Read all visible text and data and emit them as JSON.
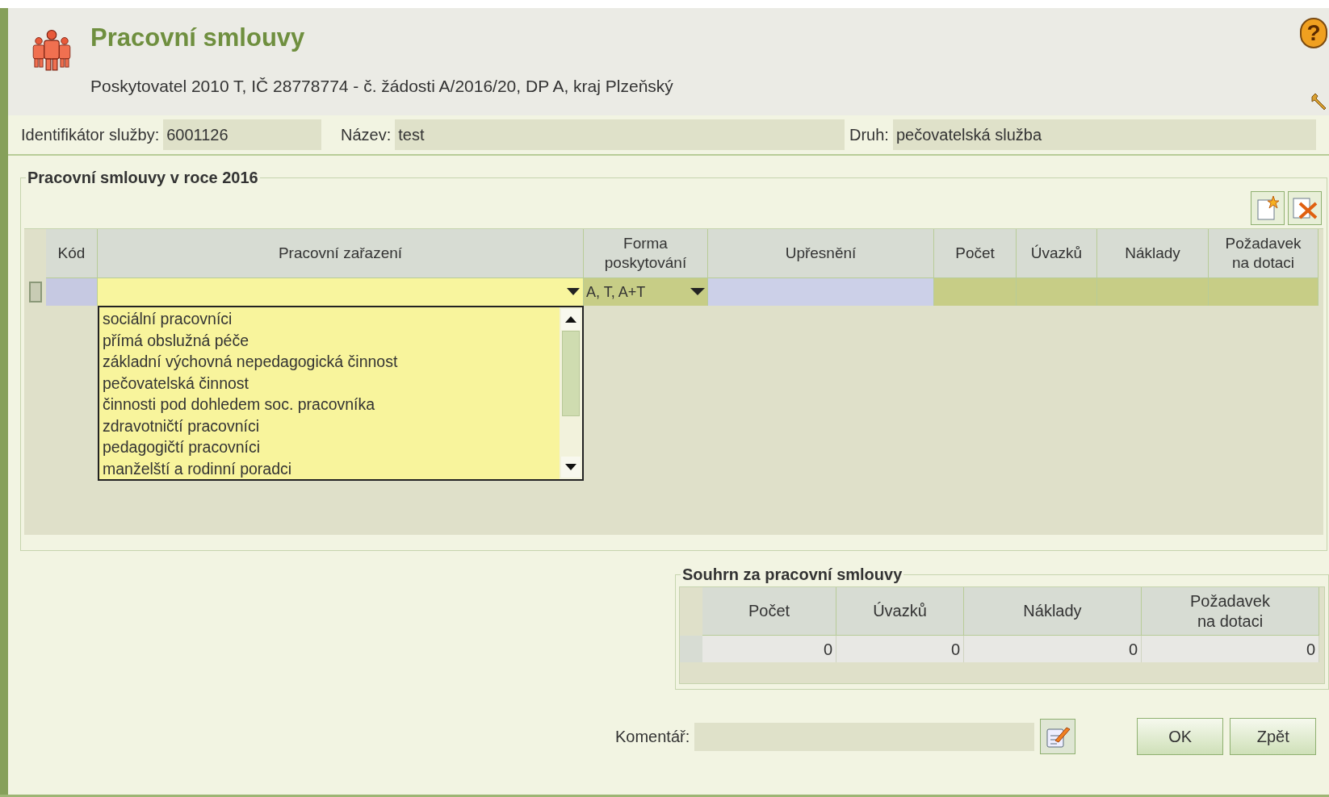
{
  "header": {
    "title": "Pracovní smlouvy",
    "subtitle": "Poskytovatel 2010 T, IČ 28778774 - č. žádosti A/2016/20, DP A, kraj Plzeňský",
    "help_symbol": "?"
  },
  "info": [
    {
      "label": "Identifikátor služby:",
      "value": "6001126"
    },
    {
      "label": "Název:",
      "value": "test"
    },
    {
      "label": "Druh:",
      "value": "pečovatelská služba"
    }
  ],
  "contracts": {
    "legend": "Pracovní smlouvy v roce 2016",
    "columns": [
      "Kód",
      "Pracovní zařazení",
      "Forma poskytování",
      "Upřesnění",
      "Počet",
      "Úvazků",
      "Náklady",
      "Požadavek na dotaci"
    ],
    "row": {
      "form": "A, T, A+T"
    },
    "dropdown_options": [
      "sociální pracovníci",
      "přímá obslužná péče",
      "základní výchovná nepedagogická činnost",
      "pečovatelská činnost",
      "činnosti pod dohledem soc. pracovníka",
      "zdravotničtí pracovníci",
      "pedagogičtí pracovníci",
      "manželští a rodinní poradci"
    ]
  },
  "summary": {
    "legend": "Souhrn za pracovní smlouvy",
    "columns": [
      "Počet",
      "Úvazků",
      "Náklady",
      "Požadavek na dotaci"
    ],
    "values": [
      "0",
      "0",
      "0",
      "0"
    ]
  },
  "comment": {
    "label": "Komentář:"
  },
  "buttons": [
    "OK",
    "Zpět"
  ]
}
